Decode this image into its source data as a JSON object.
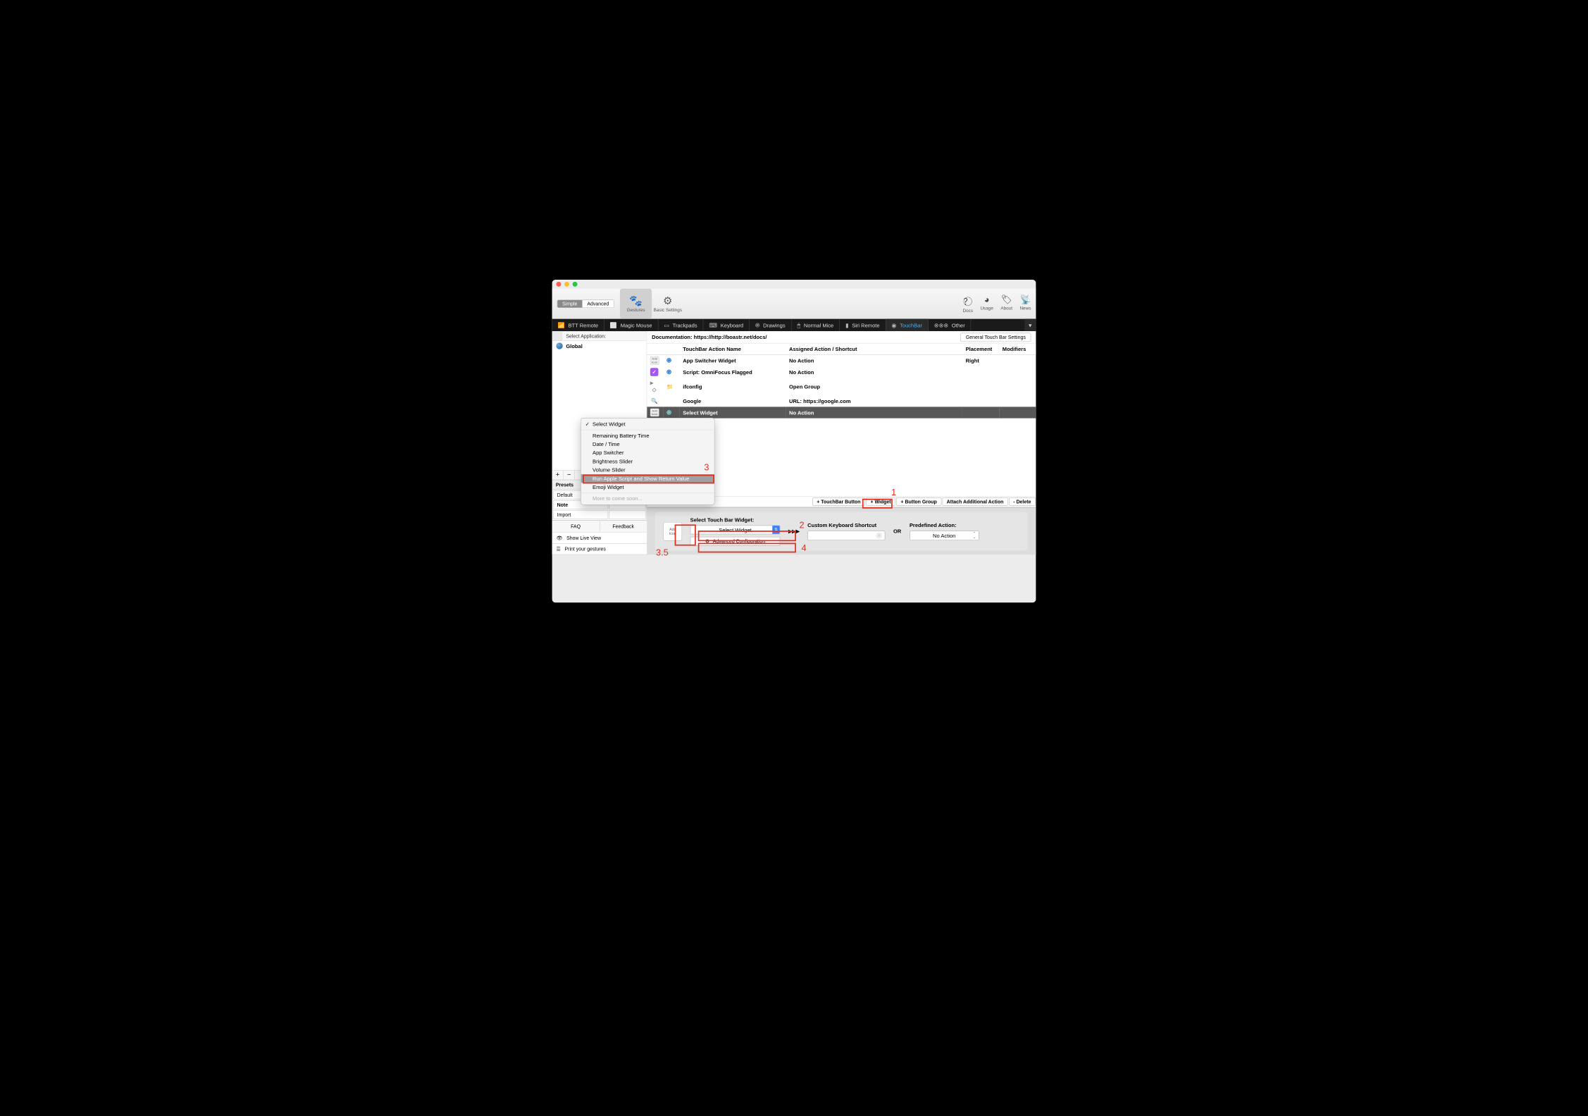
{
  "toolbar": {
    "simple": "Simple",
    "advanced": "Advanced",
    "gestures": "Gestures",
    "basic_settings": "Basic Settings",
    "docs": "Docs",
    "usage": "Usage",
    "about": "About",
    "news": "News"
  },
  "device_tabs": {
    "btt_remote": "BTT Remote",
    "magic_mouse": "Magic Mouse",
    "trackpads": "Trackpads",
    "keyboard": "Keyboard",
    "drawings": "Drawings",
    "normal_mice": "Normal Mice",
    "siri_remote": "Siri Remote",
    "touchbar": "TouchBar",
    "other": "Other"
  },
  "sidebar": {
    "header": "Select Application:",
    "global": "Global"
  },
  "docbar": {
    "label": "Documentation: https://http://boastr.net/docs/",
    "button": "General Touch Bar Settings"
  },
  "table": {
    "col_name": "TouchBar Action Name",
    "col_action": "Assigned Action / Shortcut",
    "col_placement": "Placement",
    "col_modifiers": "Modifiers",
    "rows": [
      {
        "name": "App Switcher Widget",
        "action": "No Action",
        "placement": "Right"
      },
      {
        "name": "Script: OmniFocus Flagged",
        "action": "No Action",
        "placement": ""
      },
      {
        "name": "ifconfig",
        "action": "Open Group",
        "placement": ""
      },
      {
        "name": "Google",
        "action": "URL: https://google.com",
        "placement": ""
      },
      {
        "name": "Select Widget",
        "action": "No Action",
        "placement": ""
      }
    ]
  },
  "presets": {
    "header": "Presets",
    "default": "Default",
    "note": "Note",
    "import": "Import"
  },
  "bottom": {
    "faq": "FAQ",
    "feedback": "Feedback",
    "show_live": "Show Live View",
    "print": "Print your gestures"
  },
  "actions": {
    "add_tb": "+ TouchBar Button",
    "add_widget": "+ Widget",
    "add_group": "+ Button Group",
    "attach": "Attach Additional Action",
    "delete": "- Delete"
  },
  "config": {
    "add_icon_l1": "Add",
    "add_icon_l2": "Icon",
    "select_label": "Select Touch Bar Widget:",
    "select_value": "Select Widget",
    "advanced": "Advanced Configuration",
    "kbd_label": "Custom Keyboard Shortcut",
    "or": "OR",
    "predef_label": "Predefined Action:",
    "predef_value": "No Action"
  },
  "dropdown": {
    "items": [
      "Select Widget",
      "Remaining Battery Time",
      "Date / Time",
      "App Switcher",
      "Brightness Slider",
      "Volume Slider",
      "Run Apple Script and Show Return Value",
      "Emoji Widget",
      "More to come soon..."
    ]
  },
  "annotations": {
    "n1": "1",
    "n2": "2",
    "n3": "3",
    "n35": "3.5",
    "n4": "4"
  }
}
